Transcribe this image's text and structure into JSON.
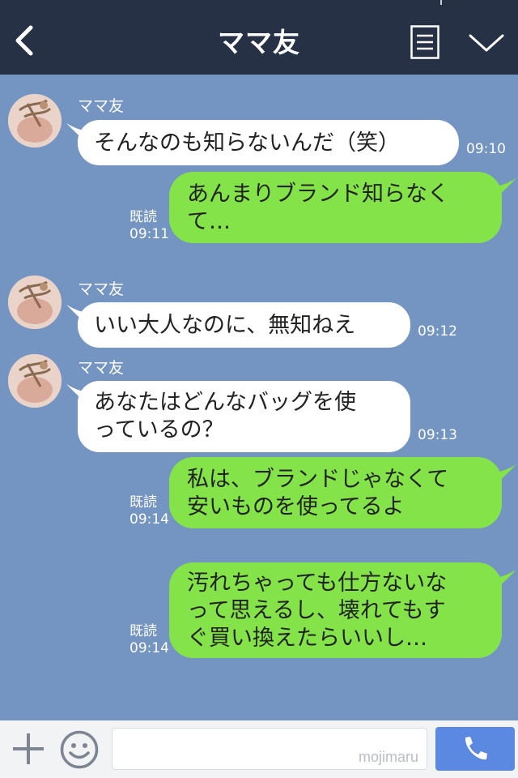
{
  "header": {
    "title": "ママ友",
    "back_icon": "chevron-left-icon",
    "menu_icon": "list-menu-icon",
    "expand_icon": "chevron-down-icon"
  },
  "chat": {
    "messages": [
      {
        "side": "in",
        "sender": "ママ友",
        "text": "そんなのも知らないんだ（笑）",
        "time": "09:10"
      },
      {
        "side": "out",
        "read": "既読",
        "text": "あんまりブランド知らなく\nて…",
        "time": "09:11"
      },
      {
        "side": "in",
        "sender": "ママ友",
        "text": "いい大人なのに、無知ねえ",
        "time": "09:12"
      },
      {
        "side": "in",
        "sender": "ママ友",
        "text": "あなたはどんなバッグを使\nっているの？",
        "time": "09:13"
      },
      {
        "side": "out",
        "read": "既読",
        "text": "私は、ブランドじゃなくて\n安いものを使ってるよ",
        "time": "09:14"
      },
      {
        "side": "out",
        "read": "既読",
        "text": "汚れちゃっても仕方ないな\nって思えるし、壊れてもす\nぐ買い換えたらいいし…",
        "time": "09:14"
      }
    ]
  },
  "footer": {
    "add_icon": "plus-icon",
    "sticker_icon": "smile-icon",
    "input_placeholder": "",
    "watermark": "mojimaru",
    "call_icon": "phone-icon"
  },
  "colors": {
    "header_bg": "#263146",
    "chat_bg": "#7494c2",
    "incoming_bubble": "#ffffff",
    "outgoing_bubble": "#85e34a",
    "call_button": "#5b88e0"
  }
}
